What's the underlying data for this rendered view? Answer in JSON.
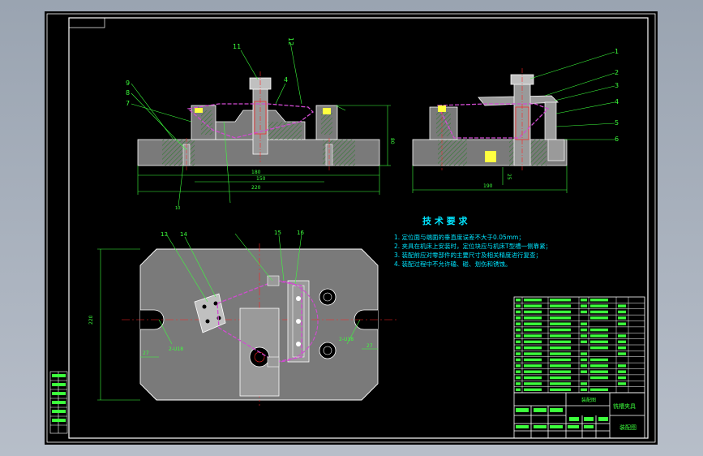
{
  "drawing": {
    "colors": {
      "viewport": "#a3acb8",
      "paper": "#000000",
      "frame": "#ffffff",
      "cyan": "#00e5ff",
      "magenta": "#d24bd2",
      "red": "#ff2020",
      "green": "#3cff3c",
      "yellow": "#ffff40",
      "body": "#7a7a7a",
      "hatch": "#3a7a3a"
    },
    "balloons_front": [
      "11",
      "12",
      "4",
      "9",
      "8",
      "7",
      "10"
    ],
    "balloons_side": [
      "1",
      "2",
      "3",
      "4",
      "5",
      "6"
    ],
    "balloons_plan": [
      "13",
      "14",
      "15",
      "16"
    ],
    "tech": {
      "title": "技 术 要 求",
      "items": [
        "1. 定位面与端面的垂直度误差不大于0.05mm；",
        "2. 夹具在机床上安装时，定位块应与机床T型槽一侧靠紧；",
        "3. 装配前应对零部件的主要尺寸及相关精度进行复查；",
        "4. 装配过程中不允许磕、碰、划伤和锈蚀。"
      ]
    },
    "title_block": {
      "title": "铣槽夹具",
      "drawing_name": "装配图"
    }
  }
}
